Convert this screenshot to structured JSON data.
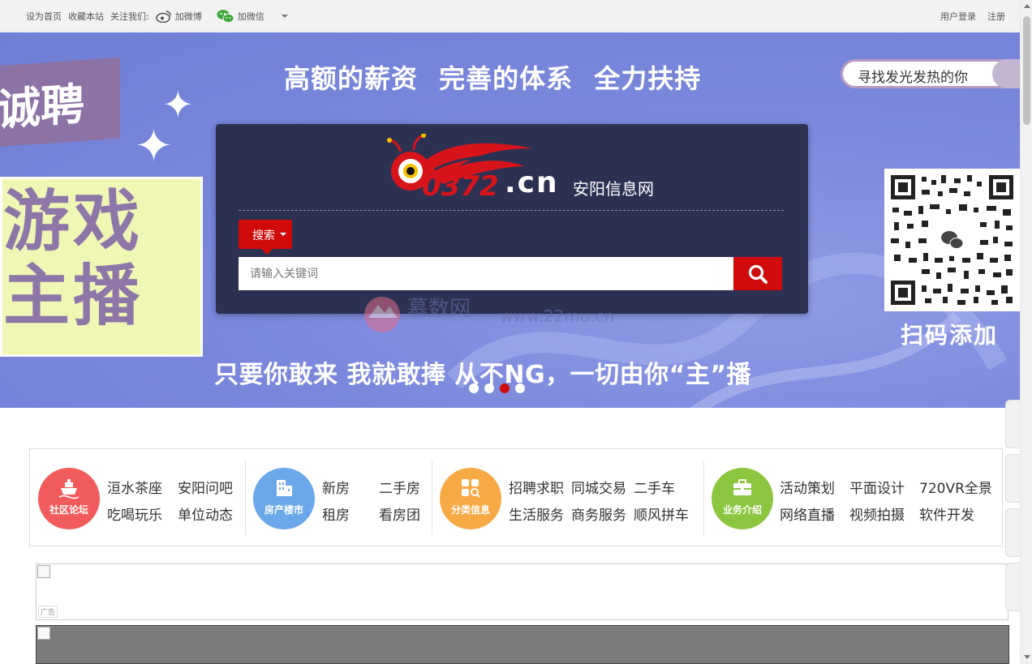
{
  "topbar": {
    "set_home": "设为首页",
    "bookmark": "收藏本站",
    "follow_us": "关注我们:",
    "weibo": "加微博",
    "wechat": "加微信",
    "login": "用户登录",
    "register": "注册"
  },
  "banner": {
    "slogan_top": "高额的薪资 完善的体系 全力扶持",
    "slogan_bottom": "只要你敢来 我就敢捧 从不NG，一切由你“主”播",
    "left_title": "诚聘",
    "left_game": "游戏",
    "left_host": "主播",
    "join_pill": "寻找发光发热的你",
    "scan_text": "扫码添加",
    "active_slide_index": 3,
    "slide_count": 4
  },
  "search": {
    "logo_domain": "0372.cn",
    "logo_site_name": "安阳信息网",
    "type_label": "搜索",
    "placeholder": "请输入关键词"
  },
  "watermark": {
    "name": "慕数网",
    "url": "www.22mu.cn"
  },
  "nav": {
    "groups": [
      {
        "label": "社区论坛",
        "color": "#f25b5b",
        "icon": "forum-boat-icon",
        "links": [
          "洹水茶座",
          "安阳问吧",
          "吃喝玩乐",
          "单位动态"
        ]
      },
      {
        "label": "房产楼市",
        "color": "#6ba8ea",
        "icon": "building-icon",
        "links": [
          "新房",
          "二手房",
          "租房",
          "看房团"
        ]
      },
      {
        "label": "分类信息",
        "color": "#f7a945",
        "icon": "grid-search-icon",
        "links": [
          "招聘求职",
          "同城交易",
          "二手车",
          "生活服务",
          "商务服务",
          "顺风拼车"
        ]
      },
      {
        "label": "业务介绍",
        "color": "#8cc63f",
        "icon": "briefcase-icon",
        "links": [
          "活动策划",
          "平面设计",
          "720VR全景",
          "网络直播",
          "视频拍摄",
          "软件开发"
        ]
      }
    ]
  },
  "ads": {
    "tag": "广告"
  },
  "colors": {
    "accent_red": "#d10b0b",
    "banner_bg": "#7b88dc",
    "panel_bg": "#2c3152"
  }
}
